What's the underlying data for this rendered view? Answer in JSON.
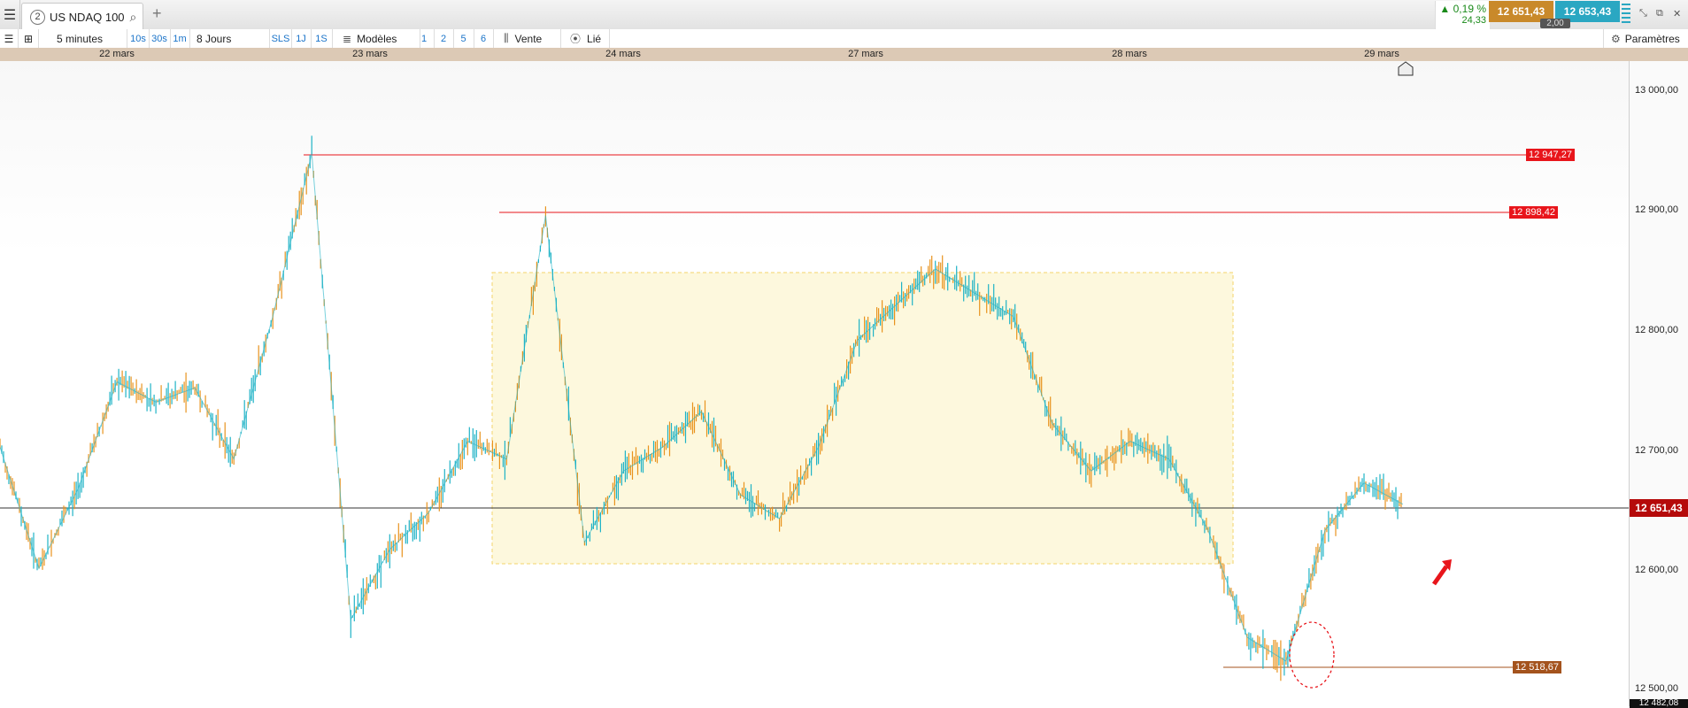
{
  "tabbar": {
    "menu_icon": "hamburger-icon",
    "tab_number": "2",
    "tab_title": "US NDAQ 100",
    "add_tab_label": "+",
    "quote": {
      "change_pct": "▲ 0,19 %",
      "change_abs": "24,33"
    },
    "bid": "12 651,43",
    "ask": "12 653,43",
    "spread": "2,00"
  },
  "toolbar": {
    "interval": "5 minutes",
    "btn_10s": "10s",
    "btn_30s": "30s",
    "btn_1m": "1m",
    "range": "8 Jours",
    "btn_sls": "SLS",
    "btn_1j": "1J",
    "btn_1s": "1S",
    "models_label": "Modèles",
    "btn_1": "1",
    "btn_2": "2",
    "btn_5": "5",
    "btn_6": "6",
    "sell_label": "Vente",
    "linked_label": "Lié",
    "settings_label": "Paramètres"
  },
  "dates": [
    {
      "label": "22 mars"
    },
    {
      "label": "23 mars"
    },
    {
      "label": "24 mars"
    },
    {
      "label": "27 mars"
    },
    {
      "label": "28 mars"
    },
    {
      "label": "29 mars"
    }
  ],
  "price_axis": [
    "13 000,00",
    "12 900,00",
    "12 800,00",
    "12 700,00",
    "12 600,00",
    "12 500,00"
  ],
  "levels": {
    "resistance_1": "12 947,27",
    "resistance_2": "12 898,42",
    "support": "12 518,67",
    "current": "12 651,43",
    "bottom_visible": "12 482,08"
  },
  "colors": {
    "bid": "#c9892a",
    "ask": "#2aa7c2",
    "current_price": "#b50a0a",
    "resistance": "#e8151b",
    "support": "#a4531d",
    "candle_up": "#1fb3c6",
    "candle_down": "#e8931e",
    "range_box": "#fdf8dd"
  },
  "chart_data": {
    "type": "line",
    "title": "",
    "xlabel": "",
    "ylabel": "",
    "ylim": [
      12482,
      13025
    ],
    "x": [
      "22 mars",
      "22 mars",
      "22 mars",
      "22 mars",
      "22 mars",
      "22 mars",
      "22 mars",
      "23 mars",
      "23 mars",
      "23 mars",
      "23 mars",
      "23 mars",
      "23 mars",
      "23 mars",
      "24 mars",
      "24 mars",
      "24 mars",
      "24 mars",
      "24 mars",
      "24 mars",
      "24 mars",
      "27 mars",
      "27 mars",
      "27 mars",
      "27 mars",
      "27 mars",
      "27 mars",
      "27 mars",
      "28 mars",
      "28 mars",
      "28 mars",
      "28 mars",
      "28 mars",
      "28 mars",
      "28 mars",
      "29 mars",
      "29 mars"
    ],
    "series": [
      {
        "values": [
          12700,
          12598,
          12665,
          12755,
          12738,
          12750,
          12690,
          12810,
          12947,
          12555,
          12614,
          12645,
          12705,
          12690,
          12895,
          12620,
          12680,
          12700,
          12730,
          12660,
          12640,
          12700,
          12790,
          12820,
          12850,
          12830,
          12810,
          12720,
          12680,
          12705,
          12690,
          12630,
          12540,
          12520,
          12630,
          12670,
          12652
        ]
      }
    ]
  }
}
